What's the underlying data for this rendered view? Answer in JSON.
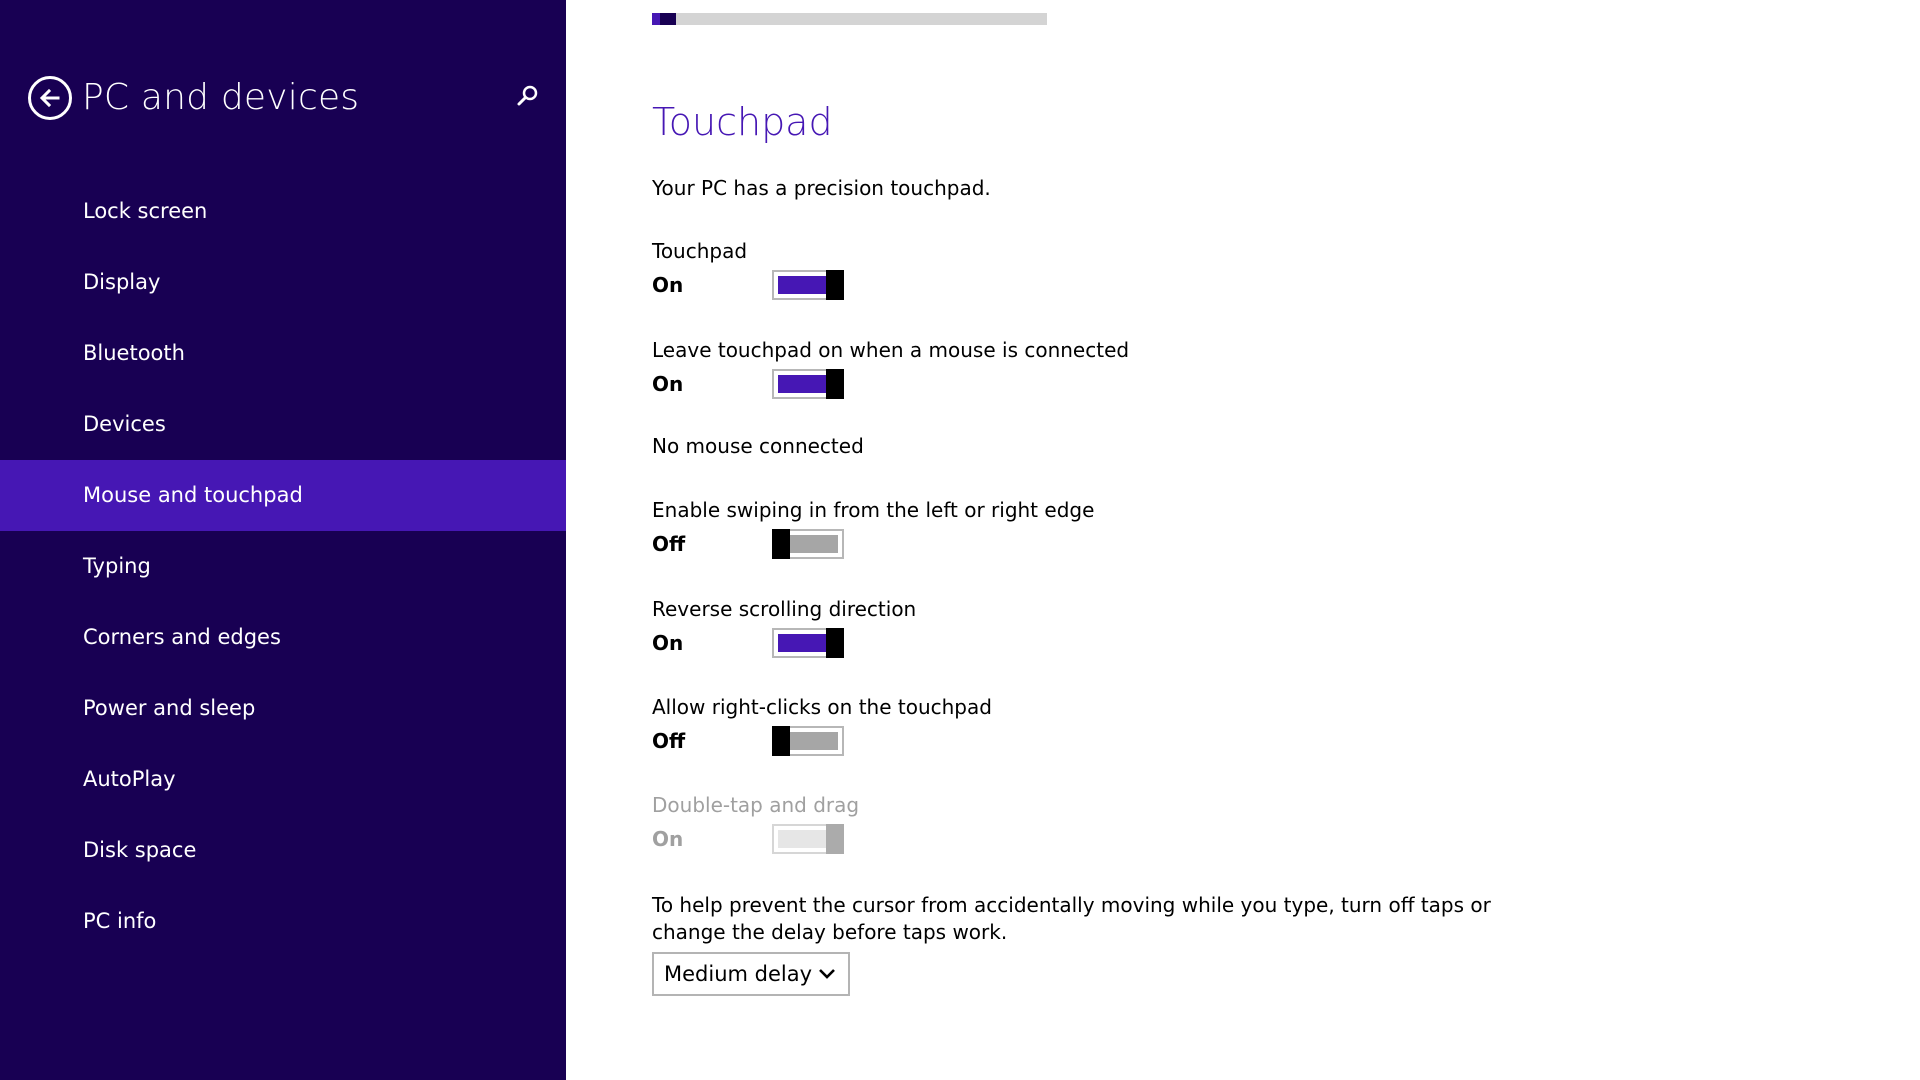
{
  "sidebar": {
    "title": "PC and devices",
    "items": [
      {
        "label": "Lock screen"
      },
      {
        "label": "Display"
      },
      {
        "label": "Bluetooth"
      },
      {
        "label": "Devices"
      },
      {
        "label": "Mouse and touchpad",
        "active": true
      },
      {
        "label": "Typing"
      },
      {
        "label": "Corners and edges"
      },
      {
        "label": "Power and sleep"
      },
      {
        "label": "AutoPlay"
      },
      {
        "label": "Disk space"
      },
      {
        "label": "PC info"
      }
    ]
  },
  "icons": {
    "back": "back-arrow-icon",
    "search": "search-icon",
    "dropdown": "chevron-down-icon"
  },
  "colors": {
    "sidebar_bg": "#180053",
    "accent": "#4617b4",
    "toggle_off": "#a6a6a6",
    "disabled_text": "#a0a0a0"
  },
  "loading_progress": 0.06,
  "main": {
    "section_title": "Touchpad",
    "description": "Your PC has a precision touchpad.",
    "settings": {
      "touchpad": {
        "label": "Touchpad",
        "state": "On"
      },
      "leave_on": {
        "label": "Leave touchpad on when a mouse is connected",
        "state": "On"
      },
      "swipe_edge": {
        "label": "Enable swiping in from the left or right edge",
        "state": "Off"
      },
      "reverse_scroll": {
        "label": "Reverse scrolling direction",
        "state": "On"
      },
      "right_click": {
        "label": "Allow right-clicks on the touchpad",
        "state": "Off"
      },
      "double_tap": {
        "label": "Double-tap and drag",
        "state": "On",
        "disabled": true
      }
    },
    "no_mouse_text": "No mouse connected",
    "help_text": "To help prevent the cursor from accidentally moving while you type, turn off taps or change the delay before taps work.",
    "delay_select": {
      "value": "Medium delay"
    }
  }
}
